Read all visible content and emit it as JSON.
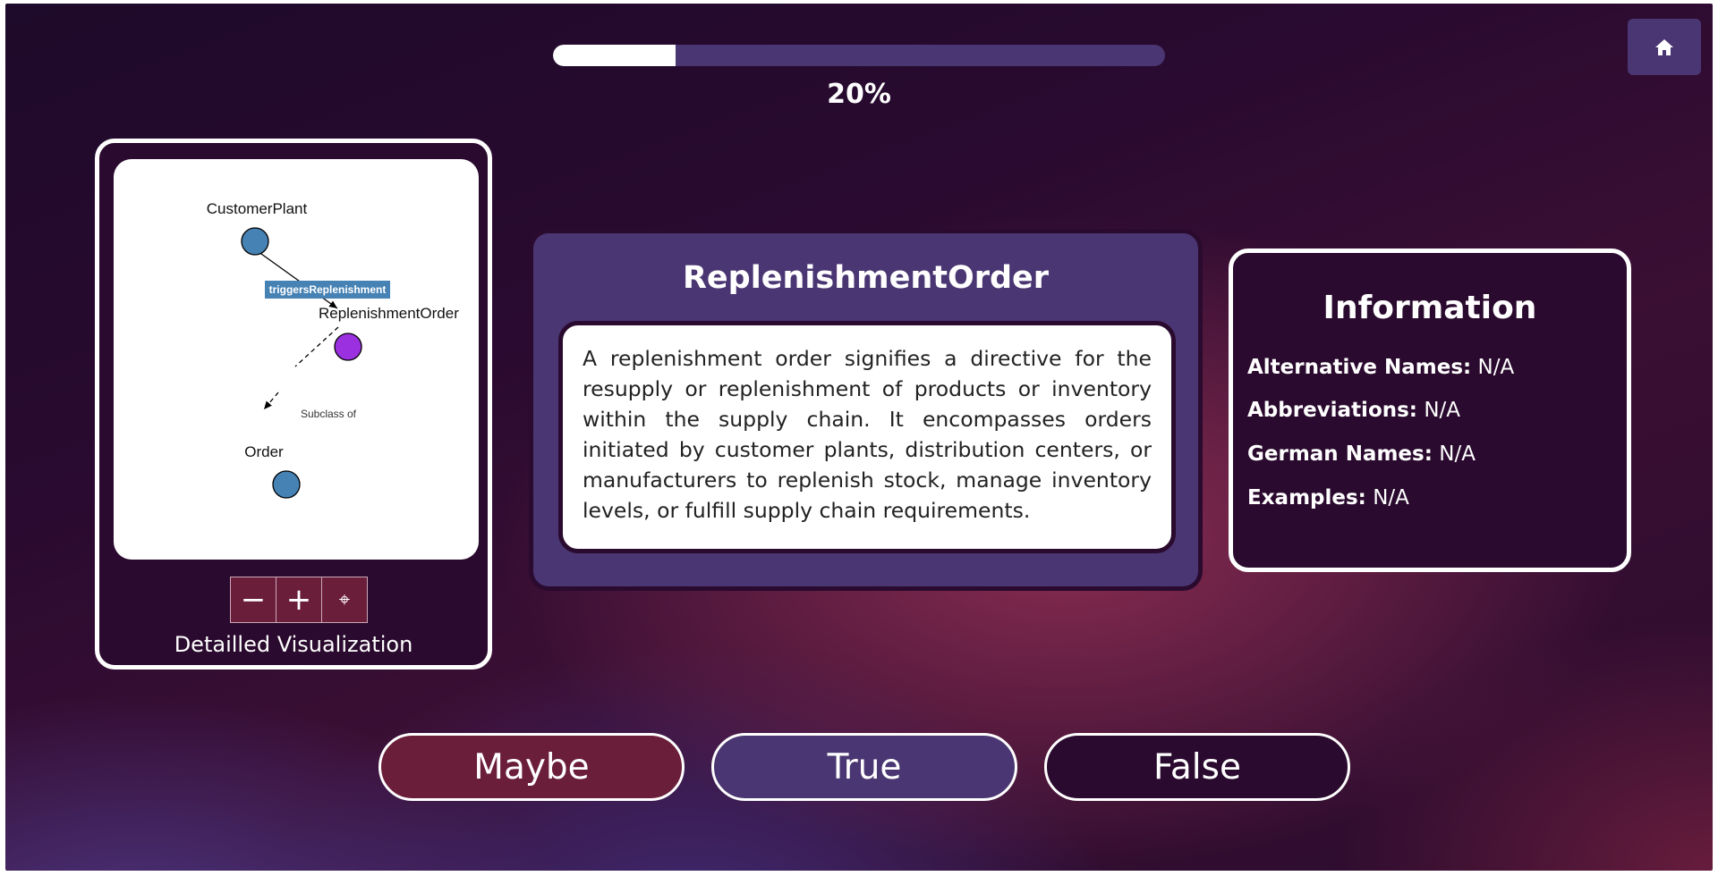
{
  "progress": {
    "label": "20%",
    "fraction": 0.2
  },
  "home": {
    "icon": "home-icon"
  },
  "visualization": {
    "label": "Detailled Visualization",
    "controls": {
      "zoom_out": "−",
      "zoom_in": "+",
      "center": "⌖"
    },
    "graph": {
      "nodes": [
        {
          "id": "CustomerPlant",
          "label": "CustomerPlant",
          "color": "#4682b4"
        },
        {
          "id": "ReplenishmentOrder",
          "label": "ReplenishmentOrder",
          "color": "#9b30e0"
        },
        {
          "id": "Order",
          "label": "Order",
          "color": "#4682b4"
        }
      ],
      "edges": [
        {
          "from": "CustomerPlant",
          "to": "ReplenishmentOrder",
          "label": "triggersReplenishment",
          "style": "solid",
          "label_bg": "#4682b4"
        },
        {
          "from": "ReplenishmentOrder",
          "to": "Order",
          "label": "Subclass of",
          "style": "dashed"
        }
      ]
    }
  },
  "concept": {
    "title": "ReplenishmentOrder",
    "description": "A replenishment order signifies a directive for the resupply or replenishment of products or inventory within the supply chain. It encompasses orders initiated by customer plants, distribution centers, or manufacturers to replenish stock, manage inventory levels, or fulfill supply chain requirements."
  },
  "information": {
    "title": "Information",
    "rows": [
      {
        "label": "Alternative Names:",
        "value": "N/A"
      },
      {
        "label": "Abbreviations:",
        "value": "N/A"
      },
      {
        "label": "German Names:",
        "value": "N/A"
      },
      {
        "label": "Examples:",
        "value": "N/A"
      }
    ]
  },
  "answers": {
    "maybe": "Maybe",
    "true": "True",
    "false": "False"
  },
  "colors": {
    "accent_purple": "#4a3672",
    "accent_maroon": "#6b1e3a",
    "dark": "#2a0a2e"
  }
}
